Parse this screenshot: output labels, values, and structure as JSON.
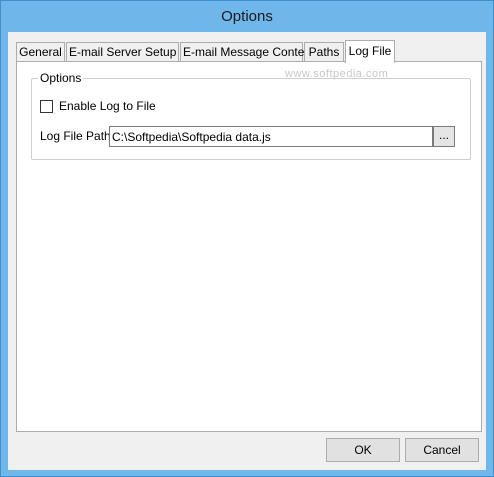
{
  "window": {
    "title": "Options"
  },
  "tabs": [
    {
      "label": "General"
    },
    {
      "label": "E-mail Server Setup"
    },
    {
      "label": "E-mail Message Content"
    },
    {
      "label": "Paths"
    },
    {
      "label": "Log File",
      "selected": true
    }
  ],
  "options_group": {
    "title": "Options",
    "enable_log_label": "Enable Log to File",
    "enable_log_checked": false,
    "log_path_label": "Log File Path:",
    "log_path_value": "C:\\Softpedia\\Softpedia data.js",
    "browse_label": "..."
  },
  "watermark": "www.softpedia.com",
  "buttons": {
    "ok": "OK",
    "cancel": "Cancel"
  }
}
